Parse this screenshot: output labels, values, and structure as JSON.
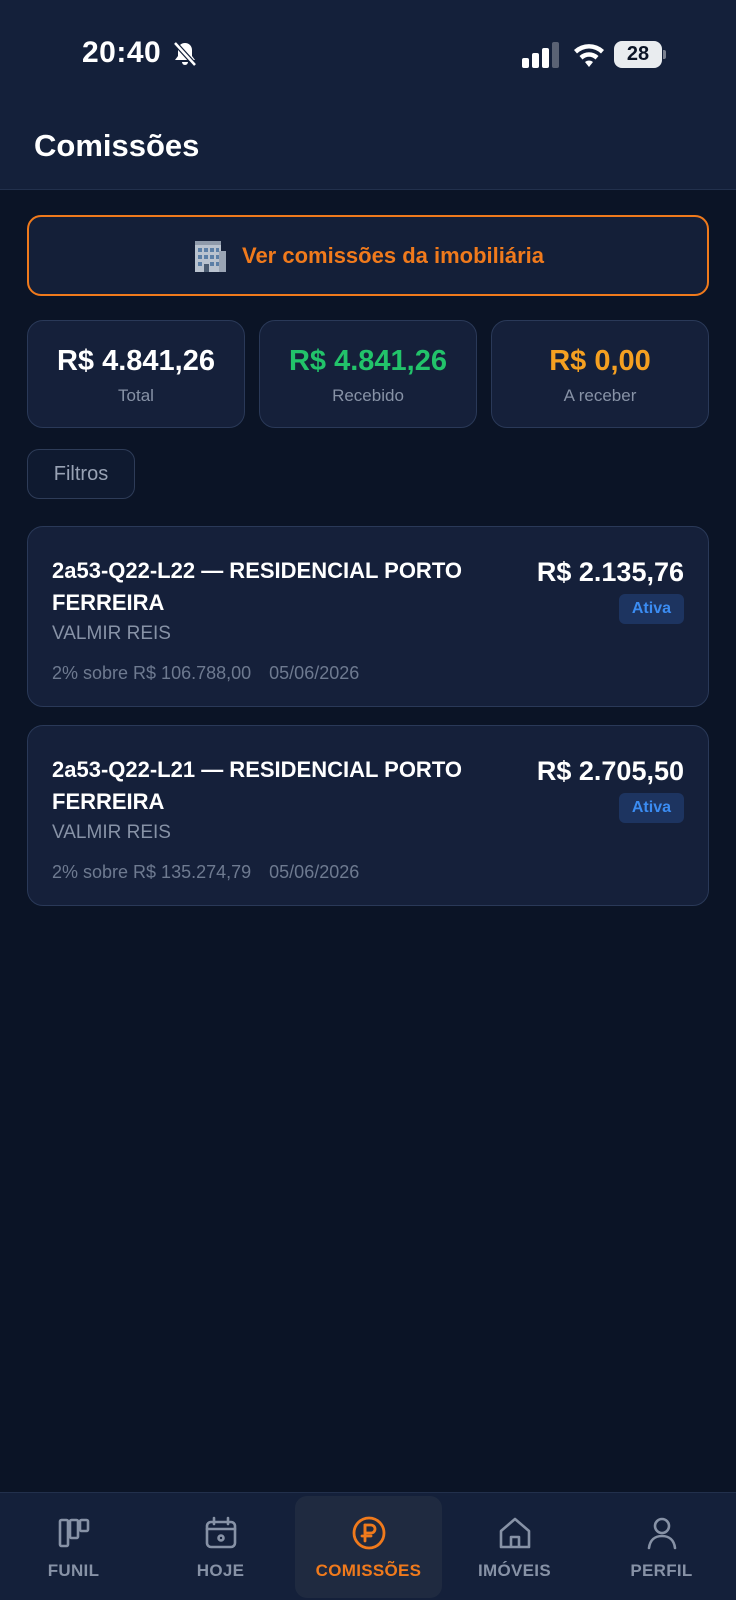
{
  "status_bar": {
    "time": "20:40",
    "battery": "28"
  },
  "header": {
    "title": "Comissões"
  },
  "cta": {
    "label": "Ver comissões da imobiliária",
    "icon": "building-icon"
  },
  "summary": [
    {
      "amount": "R$ 4.841,26",
      "caption": "Total",
      "color": "#ffffff"
    },
    {
      "amount": "R$ 4.841,26",
      "caption": "Recebido",
      "color": "#22c36a"
    },
    {
      "amount": "R$ 0,00",
      "caption": "A receber",
      "color": "#f5a021"
    }
  ],
  "filters": {
    "label": "Filtros"
  },
  "commissions": [
    {
      "title": "2a53-Q22-L22 — RESIDENCIAL PORTO FERREIRA",
      "value": "R$ 2.135,76",
      "status": "Ativa",
      "client": "VALMIR REIS",
      "basis": "2% sobre R$ 106.788,00",
      "date": "05/06/2026"
    },
    {
      "title": "2a53-Q22-L21 — RESIDENCIAL PORTO FERREIRA",
      "value": "R$ 2.705,50",
      "status": "Ativa",
      "client": "VALMIR REIS",
      "basis": "2% sobre R$ 135.274,79",
      "date": "05/06/2026"
    }
  ],
  "tabs": [
    {
      "label": "FUNIL",
      "icon": "kanban-icon",
      "active": false
    },
    {
      "label": "HOJE",
      "icon": "calendar-icon",
      "active": false
    },
    {
      "label": "COMISSÕES",
      "icon": "coin-icon",
      "active": true
    },
    {
      "label": "IMÓVEIS",
      "icon": "home-icon",
      "active": false
    },
    {
      "label": "PERFIL",
      "icon": "user-icon",
      "active": false
    }
  ],
  "colors": {
    "accent": "#f07a1c",
    "background": "#0b1426",
    "card": "#15203a",
    "badge_text": "#3b8cf2"
  }
}
